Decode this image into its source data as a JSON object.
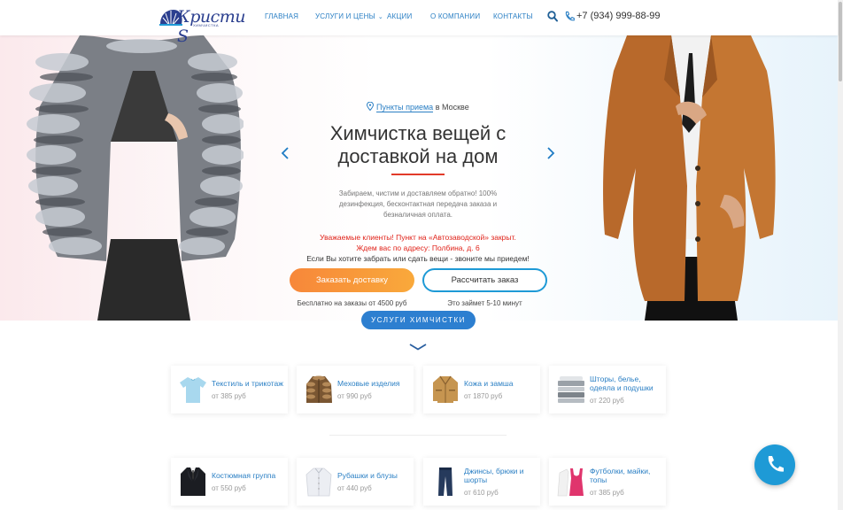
{
  "header": {
    "logo_text": "Кристи S",
    "logo_sub": "ХИМЧИСТКА",
    "nav": [
      {
        "label": "Главная"
      },
      {
        "label": "Услуги и цены"
      },
      {
        "label": "Акции"
      },
      {
        "label": "О компании"
      },
      {
        "label": "Контакты"
      }
    ],
    "phone": "+7 (934) 999-88-99"
  },
  "hero": {
    "location_link": "Пункты приема",
    "location_rest": " в Москве",
    "title": "Химчистка вещей с доставкой на дом",
    "description": "Забираем, чистим и доставляем обратно! 100% дезинфекция, бесконтактная передача заказа и безналичная оплата.",
    "notice_1": "Уважаемые клиенты! Пункт на «Автозаводской» закрыт.",
    "notice_2": "Ждем вас по адресу: Полбина, д. 6",
    "notice_3": "Если Вы хотите забрать или сдать вещи - звоните мы приедем!",
    "btn_order": "Заказать доставку",
    "btn_calc": "Рассчитать заказ",
    "sub_order": "Бесплатно на заказы от 4500 руб",
    "sub_calc": "Это займет 5-10 минут"
  },
  "services": {
    "button": "Услуги химчистки",
    "cards": [
      {
        "name": "Текстиль и трикотаж",
        "price": "от 385 руб",
        "icon": "tshirt-icon"
      },
      {
        "name": "Меховые изделия",
        "price": "от 990 руб",
        "icon": "fur-coat-icon"
      },
      {
        "name": "Кожа и замша",
        "price": "от 1870 руб",
        "icon": "leather-jacket-icon"
      },
      {
        "name": "Шторы, белье, одеяла и подушки",
        "price": "от 220 руб",
        "icon": "linen-icon"
      },
      {
        "name": "Костюмная группа",
        "price": "от 550 руб",
        "icon": "suit-icon"
      },
      {
        "name": "Рубашки и блузы",
        "price": "от 440 руб",
        "icon": "shirt-icon"
      },
      {
        "name": "Джинсы, брюки и шорты",
        "price": "от 610 руб",
        "icon": "jeans-icon"
      },
      {
        "name": "Футболки, майки, топы",
        "price": "от 385 руб",
        "icon": "top-icon"
      }
    ]
  },
  "colors": {
    "accent_blue": "#2a7fc4",
    "button_blue": "#2d7fd0",
    "orange": "#f7873a",
    "red": "#e0231a"
  }
}
